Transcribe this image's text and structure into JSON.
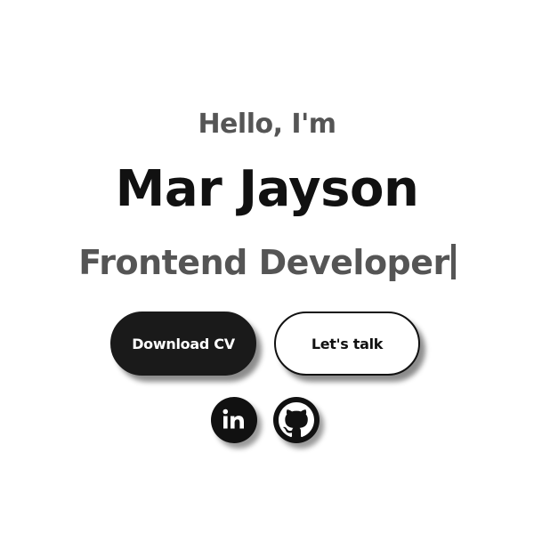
{
  "hero": {
    "greeting": "Hello, I'm",
    "name": "Mar Jayson",
    "role": "Frontend Developer"
  },
  "actions": {
    "download_label": "Download CV",
    "talk_label": "Let's talk"
  },
  "social": {
    "linkedin_icon": "linkedin-icon",
    "github_icon": "github-icon"
  },
  "colors": {
    "background": "#ffffff",
    "primary": "#1a1a1a",
    "muted_text": "#555555"
  }
}
